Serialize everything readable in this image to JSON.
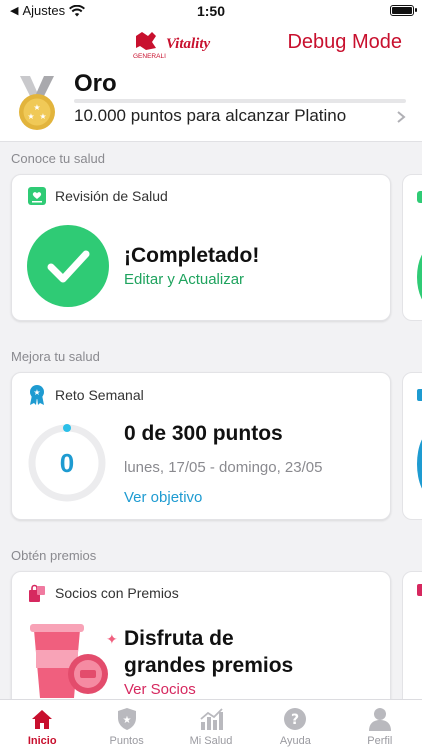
{
  "status_bar": {
    "carrier": "Ajustes",
    "time": "1:50"
  },
  "header": {
    "logo_top": "GENERALI",
    "logo_brand": "Vitality",
    "debug_label": "Debug Mode"
  },
  "status": {
    "tier": "Oro",
    "message": "10.000 puntos para alcanzar Platino",
    "progress": 0
  },
  "sections": {
    "health": {
      "label": "Conoce tu salud",
      "card_title": "Revisión de Salud",
      "headline": "¡Completado!",
      "action": "Editar y Actualizar"
    },
    "improve": {
      "label": "Mejora tu salud",
      "card_title": "Reto Semanal",
      "ring_value": "0",
      "headline": "0 de 300 puntos",
      "dates": "lunes, 17/05 - domingo, 23/05",
      "action": "Ver objetivo",
      "progress": 0
    },
    "rewards": {
      "label": "Obtén premios",
      "card_title": "Socios con Premios",
      "headline_line1": "Disfruta de",
      "headline_line2": "grandes premios",
      "action": "Ver Socios"
    }
  },
  "tabs": [
    {
      "label": "Inicio",
      "icon": "home-icon",
      "active": true
    },
    {
      "label": "Puntos",
      "icon": "shield-star-icon",
      "active": false
    },
    {
      "label": "Mi Salud",
      "icon": "bar-chart-icon",
      "active": false
    },
    {
      "label": "Ayuda",
      "icon": "help-icon",
      "active": false
    },
    {
      "label": "Perfil",
      "icon": "person-icon",
      "active": false
    }
  ],
  "colors": {
    "brand_red": "#c8102e",
    "success_green": "#2fcb75",
    "link_blue": "#1e9bd1",
    "rewards_pink": "#d6285f",
    "medal_gold": "#e2b43c"
  }
}
